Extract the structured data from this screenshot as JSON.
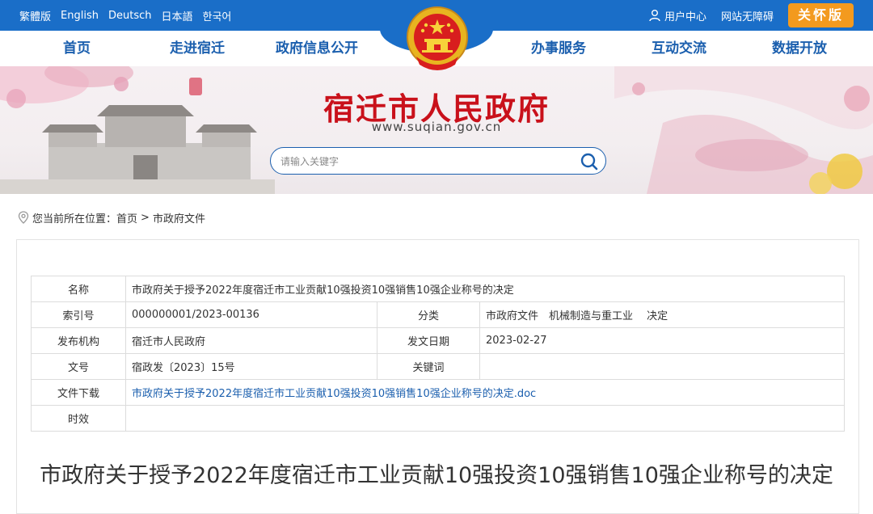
{
  "topbar": {
    "languages": [
      "繁體版",
      "English",
      "Deutsch",
      "日本語",
      "한국어"
    ],
    "user_center": "用户中心",
    "accessibility": "网站无障碍",
    "care_version": "关怀版"
  },
  "nav": {
    "items": [
      "首页",
      "走进宿迁",
      "政府信息公开",
      "办事服务",
      "互动交流",
      "数据开放"
    ]
  },
  "banner": {
    "title": "宿迁市人民政府",
    "url": "www.suqian.gov.cn",
    "search_placeholder": "请输入关键字"
  },
  "breadcrumb": {
    "prefix": "您当前所在位置：",
    "items": [
      "首页",
      "市政府文件"
    ],
    "separator": ">"
  },
  "info_table": {
    "name_label": "名称",
    "name_value": "市政府关于授予2022年度宿迁市工业贡献10强投资10强销售10强企业称号的决定",
    "index_label": "索引号",
    "index_value": "000000001/2023-00136",
    "category_label": "分类",
    "category_value": "市政府文件　机械制造与重工业　 决定",
    "publisher_label": "发布机构",
    "publisher_value": "宿迁市人民政府",
    "date_label": "发文日期",
    "date_value": "2023-02-27",
    "doc_no_label": "文号",
    "doc_no_value": "宿政发〔2023〕15号",
    "keywords_label": "关键词",
    "keywords_value": "",
    "download_label": "文件下载",
    "download_value": "市政府关于授予2022年度宿迁市工业贡献10强投资10强销售10强企业称号的决定.doc",
    "validity_label": "时效",
    "validity_value": ""
  },
  "document": {
    "title": "市政府关于授予2022年度宿迁市工业贡献10强投资10强销售10强企业称号的决定"
  },
  "colors": {
    "topbar_bg": "#1a6ec8",
    "nav_text": "#1b5fae",
    "care_button": "#f39a1e",
    "site_title": "#c9111b",
    "link": "#1b5fae"
  }
}
